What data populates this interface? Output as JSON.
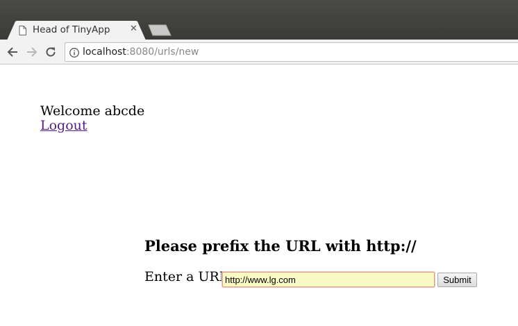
{
  "browser": {
    "tab": {
      "title": "Head of TinyApp",
      "close_glyph": "✕",
      "icon": "page-icon"
    },
    "address_bar": {
      "host": "localhost",
      "rest": ":8080/urls/new",
      "icon": "info-icon"
    },
    "nav_icons": [
      "back-arrow-icon",
      "forward-arrow-icon",
      "reload-icon"
    ]
  },
  "page": {
    "welcome_text": "Welcome abcde",
    "logout_label": "Logout",
    "heading": "Please prefix the URL with http://",
    "url_label": "Enter a URL:",
    "url_value": "http://www.lg.com",
    "submit_label": "Submit"
  }
}
